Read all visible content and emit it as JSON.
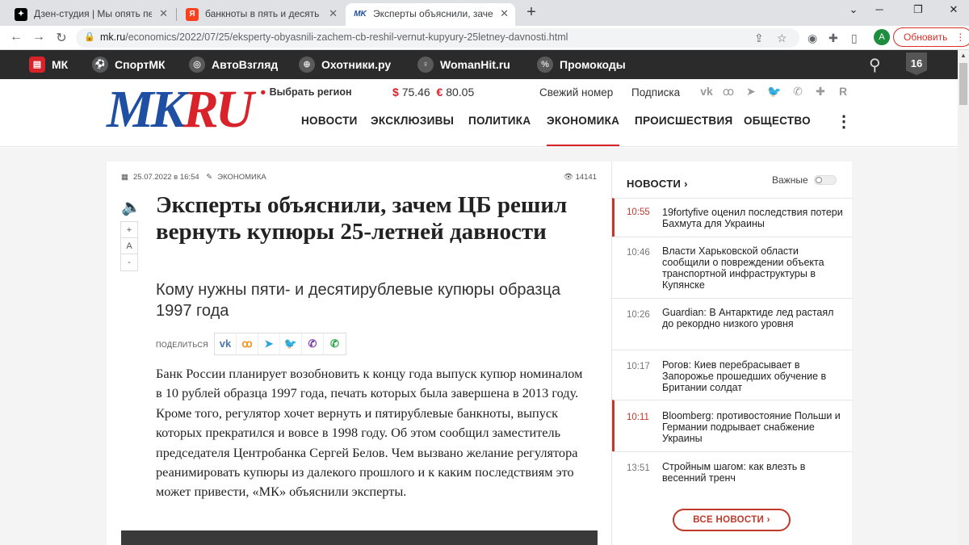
{
  "browser": {
    "tabs": [
      {
        "title": "Дзен-студия | Мы опять первые",
        "icon": "dzen-icon",
        "active": false
      },
      {
        "title": "банкноты в пять и десять рублей",
        "icon": "yandex-icon",
        "active": false
      },
      {
        "title": "Эксперты объяснили, зачем ЦБ",
        "icon": "mk-icon",
        "active": true
      }
    ],
    "url_domain": "mk.ru",
    "url_path": "/economics/2022/07/25/eksperty-obyasnili-zachem-cb-reshil-vernut-kupyury-25letney-davnosti.html",
    "avatar_letter": "A",
    "update_label": "Обновить"
  },
  "portal": {
    "items": [
      {
        "label": "МК",
        "icon": "mk-logo-icon"
      },
      {
        "label": "СпортМК",
        "icon": "ball-icon"
      },
      {
        "label": "АвтоВзгляд",
        "icon": "wheel-icon"
      },
      {
        "label": "Охотники.ру",
        "icon": "target-icon"
      },
      {
        "label": "WomanHit.ru",
        "icon": "female-icon"
      },
      {
        "label": "Промокоды",
        "icon": "coupon-icon"
      }
    ],
    "age": "16"
  },
  "header": {
    "logo_mk": "MK",
    "logo_ru": "RU",
    "region": "Выбрать регион",
    "usd": "75.46",
    "eur": "80.05",
    "fresh_issue": "Свежий номер",
    "subscription": "Подписка",
    "nav": [
      "НОВОСТИ",
      "ЭКСКЛЮЗИВЫ",
      "ПОЛИТИКА",
      "ЭКОНОМИКА",
      "ПРОИСШЕСТВИЯ",
      "ОБЩЕСТВО"
    ],
    "active_nav": "ЭКОНОМИКА"
  },
  "article": {
    "date": "25.07.2022 в 16:54",
    "rubric": "ЭКОНОМИКА",
    "views": "14141",
    "title": "Эксперты объяснили, зачем ЦБ решил вернуть купюры 25-летней давности",
    "subtitle": "Кому нужны пяти- и десятирублевые купюры образца 1997 года",
    "share_label": "ПОДЕЛИТЬСЯ",
    "font_controls": [
      "+",
      "A",
      "-"
    ],
    "body": "Банк России планирует возобновить к концу года выпуск купюр номиналом в 10 рублей образца 1997 года, печать которых была завершена в 2013 году. Кроме того, регулятор хочет вернуть и пятирублевые банкноты, выпуск которых прекратился и вовсе в 1998 году. Об этом сообщил заместитель председателя Центробанка Сергей Белов. Чем вызвано желание регулятора реанимировать купюры из далекого прошлого и к каким последствиям это может привести, «МК» объяснили эксперты."
  },
  "sidebar": {
    "title": "НОВОСТИ",
    "important_label": "Важные",
    "news": [
      {
        "time": "10:55",
        "text": "19fortyfive оценил последствия потери Бахмута для Украины",
        "highlight": true
      },
      {
        "time": "10:46",
        "text": "Власти Харьковской области сообщили о повреждении объекта транспортной инфраструктуры в Купянске",
        "highlight": false
      },
      {
        "time": "10:26",
        "text": "Guardian: В Антарктиде лед растаял до рекордно низкого уровня",
        "highlight": false
      },
      {
        "time": "10:17",
        "text": "Рогов: Киев перебрасывает в Запорожье прошедших обучение в Британии солдат",
        "highlight": false
      },
      {
        "time": "10:11",
        "text": "Bloomberg: противостояние Польши и Германии подрывает снабжение Украины",
        "highlight": true
      },
      {
        "time": "13:51",
        "text": "Стройным шагом: как влезть в весенний тренч",
        "highlight": false
      }
    ],
    "all_news": "ВСЕ НОВОСТИ"
  },
  "colors": {
    "brand_red": "#d8232a",
    "brand_blue": "#1f4fa3"
  }
}
